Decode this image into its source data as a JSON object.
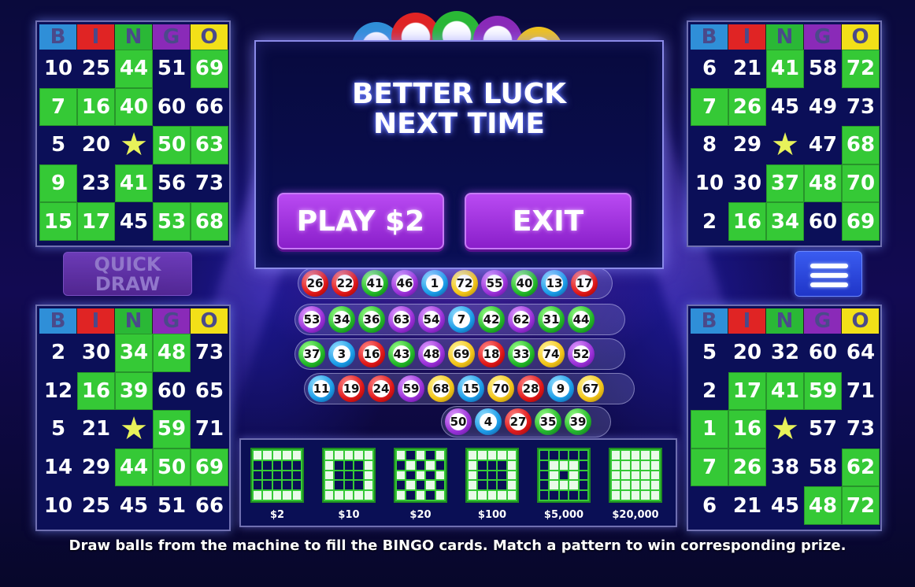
{
  "header_letters": [
    "B",
    "I",
    "N",
    "G",
    "O"
  ],
  "header_colors": [
    "#2f8fd8",
    "#e02424",
    "#2ab836",
    "#8a2ab8",
    "#f2e018"
  ],
  "logo_colors": [
    "#e02424",
    "#2ab836",
    "#8a2ab8",
    "#f2c418"
  ],
  "cards": [
    {
      "name": "top-left",
      "rows": [
        [
          "10",
          "25",
          "44",
          "51",
          "69"
        ],
        [
          "7",
          "16",
          "40",
          "60",
          "66"
        ],
        [
          "5",
          "20",
          "★",
          "50",
          "63"
        ],
        [
          "9",
          "23",
          "41",
          "56",
          "73"
        ],
        [
          "15",
          "17",
          "45",
          "53",
          "68"
        ]
      ],
      "marked": [
        [
          0,
          0,
          1,
          0,
          1
        ],
        [
          1,
          1,
          1,
          0,
          0
        ],
        [
          0,
          0,
          0,
          1,
          1
        ],
        [
          1,
          0,
          1,
          0,
          0
        ],
        [
          1,
          1,
          0,
          1,
          1
        ]
      ]
    },
    {
      "name": "top-right",
      "rows": [
        [
          "6",
          "21",
          "41",
          "58",
          "72"
        ],
        [
          "7",
          "26",
          "45",
          "49",
          "73"
        ],
        [
          "8",
          "29",
          "★",
          "47",
          "68"
        ],
        [
          "10",
          "30",
          "37",
          "48",
          "70"
        ],
        [
          "2",
          "16",
          "34",
          "60",
          "69"
        ]
      ],
      "marked": [
        [
          0,
          0,
          1,
          0,
          1
        ],
        [
          1,
          1,
          0,
          0,
          0
        ],
        [
          0,
          0,
          0,
          0,
          1
        ],
        [
          0,
          0,
          1,
          1,
          1
        ],
        [
          0,
          1,
          1,
          0,
          1
        ]
      ]
    },
    {
      "name": "bottom-left",
      "rows": [
        [
          "2",
          "30",
          "34",
          "48",
          "73"
        ],
        [
          "12",
          "16",
          "39",
          "60",
          "65"
        ],
        [
          "5",
          "21",
          "★",
          "59",
          "71"
        ],
        [
          "14",
          "29",
          "44",
          "50",
          "69"
        ],
        [
          "10",
          "25",
          "45",
          "51",
          "66"
        ]
      ],
      "marked": [
        [
          0,
          0,
          1,
          1,
          0
        ],
        [
          0,
          1,
          1,
          0,
          0
        ],
        [
          0,
          0,
          0,
          1,
          0
        ],
        [
          0,
          0,
          1,
          1,
          1
        ],
        [
          0,
          0,
          0,
          0,
          0
        ]
      ]
    },
    {
      "name": "bottom-right",
      "rows": [
        [
          "5",
          "20",
          "32",
          "60",
          "64"
        ],
        [
          "2",
          "17",
          "41",
          "59",
          "71"
        ],
        [
          "1",
          "16",
          "★",
          "57",
          "73"
        ],
        [
          "7",
          "26",
          "38",
          "58",
          "62"
        ],
        [
          "6",
          "21",
          "45",
          "48",
          "72"
        ]
      ],
      "marked": [
        [
          0,
          0,
          0,
          0,
          0
        ],
        [
          0,
          1,
          1,
          1,
          0
        ],
        [
          1,
          1,
          0,
          0,
          0
        ],
        [
          1,
          1,
          0,
          0,
          1
        ],
        [
          0,
          0,
          0,
          1,
          1
        ]
      ]
    }
  ],
  "dialog": {
    "line1": "BETTER LUCK",
    "line2": "NEXT TIME",
    "play_label": "PLAY $2",
    "exit_label": "EXIT"
  },
  "quick_draw": {
    "line1": "QUICK",
    "line2": "DRAW"
  },
  "drawn_balls": [
    [
      [
        "26",
        "red"
      ],
      [
        "22",
        "red"
      ],
      [
        "41",
        "green"
      ],
      [
        "46",
        "purple"
      ],
      [
        "1",
        "blue"
      ],
      [
        "72",
        "yellow"
      ],
      [
        "55",
        "purple"
      ],
      [
        "40",
        "green"
      ],
      [
        "13",
        "blue"
      ],
      [
        "17",
        "red"
      ]
    ],
    [
      [
        "53",
        "purple"
      ],
      [
        "34",
        "green"
      ],
      [
        "36",
        "green"
      ],
      [
        "63",
        "purple"
      ],
      [
        "54",
        "purple"
      ],
      [
        "7",
        "blue"
      ],
      [
        "42",
        "green"
      ],
      [
        "62",
        "purple"
      ],
      [
        "31",
        "green"
      ],
      [
        "44",
        "green"
      ]
    ],
    [
      [
        "37",
        "green"
      ],
      [
        "3",
        "blue"
      ],
      [
        "16",
        "red"
      ],
      [
        "43",
        "green"
      ],
      [
        "48",
        "purple"
      ],
      [
        "69",
        "yellow"
      ],
      [
        "18",
        "red"
      ],
      [
        "33",
        "green"
      ],
      [
        "74",
        "yellow"
      ],
      [
        "52",
        "purple"
      ]
    ],
    [
      [
        "11",
        "blue"
      ],
      [
        "19",
        "red"
      ],
      [
        "24",
        "red"
      ],
      [
        "59",
        "purple"
      ],
      [
        "68",
        "yellow"
      ],
      [
        "15",
        "blue"
      ],
      [
        "70",
        "yellow"
      ],
      [
        "28",
        "red"
      ],
      [
        "9",
        "blue"
      ],
      [
        "67",
        "yellow"
      ]
    ],
    [
      [
        "50",
        "purple"
      ],
      [
        "4",
        "blue"
      ],
      [
        "27",
        "red"
      ],
      [
        "35",
        "green"
      ],
      [
        "39",
        "green"
      ]
    ]
  ],
  "patterns": [
    {
      "prize": "$2",
      "grid": [
        [
          1,
          1,
          1,
          1,
          1
        ],
        [
          0,
          0,
          0,
          0,
          0
        ],
        [
          0,
          0,
          0,
          0,
          0
        ],
        [
          0,
          0,
          0,
          0,
          0
        ],
        [
          1,
          1,
          1,
          1,
          1
        ]
      ]
    },
    {
      "prize": "$10",
      "grid": [
        [
          1,
          1,
          1,
          1,
          1
        ],
        [
          1,
          0,
          0,
          0,
          1
        ],
        [
          1,
          0,
          0,
          0,
          1
        ],
        [
          1,
          0,
          0,
          0,
          1
        ],
        [
          1,
          1,
          1,
          1,
          1
        ]
      ]
    },
    {
      "prize": "$20",
      "grid": [
        [
          1,
          0,
          1,
          0,
          1
        ],
        [
          0,
          1,
          0,
          1,
          0
        ],
        [
          1,
          0,
          1,
          0,
          1
        ],
        [
          0,
          1,
          0,
          1,
          0
        ],
        [
          1,
          0,
          1,
          0,
          1
        ]
      ]
    },
    {
      "prize": "$100",
      "grid": [
        [
          1,
          1,
          1,
          1,
          1
        ],
        [
          1,
          0,
          0,
          0,
          1
        ],
        [
          1,
          0,
          0,
          0,
          1
        ],
        [
          1,
          0,
          0,
          0,
          1
        ],
        [
          1,
          1,
          1,
          1,
          1
        ]
      ]
    },
    {
      "prize": "$5,000",
      "grid": [
        [
          0,
          0,
          0,
          0,
          0
        ],
        [
          0,
          1,
          1,
          1,
          0
        ],
        [
          0,
          1,
          0,
          1,
          0
        ],
        [
          0,
          1,
          1,
          1,
          0
        ],
        [
          0,
          0,
          0,
          0,
          0
        ]
      ]
    },
    {
      "prize": "$20,000",
      "grid": [
        [
          1,
          1,
          1,
          1,
          1
        ],
        [
          1,
          1,
          1,
          1,
          1
        ],
        [
          1,
          1,
          1,
          1,
          1
        ],
        [
          1,
          1,
          1,
          1,
          1
        ],
        [
          1,
          1,
          1,
          1,
          1
        ]
      ]
    }
  ],
  "instructions": "Draw balls from the machine to fill the BINGO cards. Match a pattern to win corresponding prize."
}
